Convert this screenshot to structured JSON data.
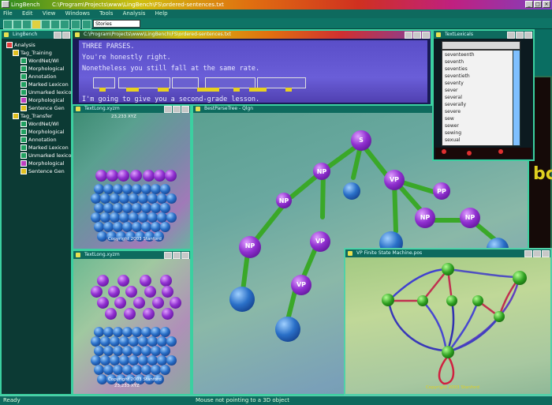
{
  "app": {
    "title": "LingBench",
    "path": "C:\\Program\\Projects\\www\\LingBench\\FS\\ordered-sentences.txt",
    "menu": [
      "File",
      "Edit",
      "View",
      "Windows",
      "Tools",
      "Analysis",
      "Help"
    ],
    "toolbar": {
      "zoom_value": "Stories"
    },
    "status": {
      "left": "Ready",
      "message": "Mouse not pointing to a 3D object"
    }
  },
  "tree": {
    "title": "LingBench",
    "root": "Analysis",
    "groups": [
      {
        "label": "Tag_Training",
        "children": [
          "WordNet/WI",
          "Morphological",
          "Annotation",
          "Marked Lexicon",
          "Unmarked lexicon",
          "Morphological",
          "Sentence Gen"
        ]
      },
      {
        "label": "Tag_Transfer",
        "children": [
          "WordNet/WI",
          "Morphological",
          "Annotation",
          "Marked Lexicon",
          "Unmarked lexicon",
          "Morphological",
          "Sentence Gen"
        ]
      }
    ]
  },
  "text_window": {
    "title": "C:\\Program\\Projects\\www\\LingBench\\FS\\ordered-sentences.txt",
    "lines": [
      "THREE PARSES.",
      "You're honestly right.",
      "Nonetheless you still fall at the same rate.",
      "",
      "I'm going to give you a second-grade lesson."
    ]
  },
  "lexicon": {
    "title": "TextLexicals",
    "entries": [
      "seventeenth",
      "seventh",
      "seventies",
      "seventieth",
      "seventy",
      "sever",
      "several",
      "severally",
      "severe",
      "sew",
      "sewer",
      "sewing",
      "sexual"
    ]
  },
  "windows": {
    "top_left": {
      "title": "TextLong.xyzm",
      "copyright": "Copyright 2003 Stanford",
      "info": "23,233 XYZ"
    },
    "bottom_left": {
      "title": "TextLong.xyzm",
      "copyright": "Copyright 2003 Stanford",
      "info": "23,233 XYZ"
    },
    "parse": {
      "title": "BestParseTree - Qlgn",
      "labels": [
        "S",
        "NP",
        "VP",
        "PP",
        "NP",
        "VP",
        "NP",
        "NP",
        "NP",
        "VP"
      ]
    },
    "fsm": {
      "title": "VP Finite State Machine.pos",
      "footer": "Copyright 2003 Stanford"
    }
  },
  "colors": {
    "accent": "#3bd0a0",
    "node_purple": "#9030d0",
    "node_blue": "#2a70c8",
    "node_green": "#2ea020",
    "edge": "#3aa828"
  }
}
